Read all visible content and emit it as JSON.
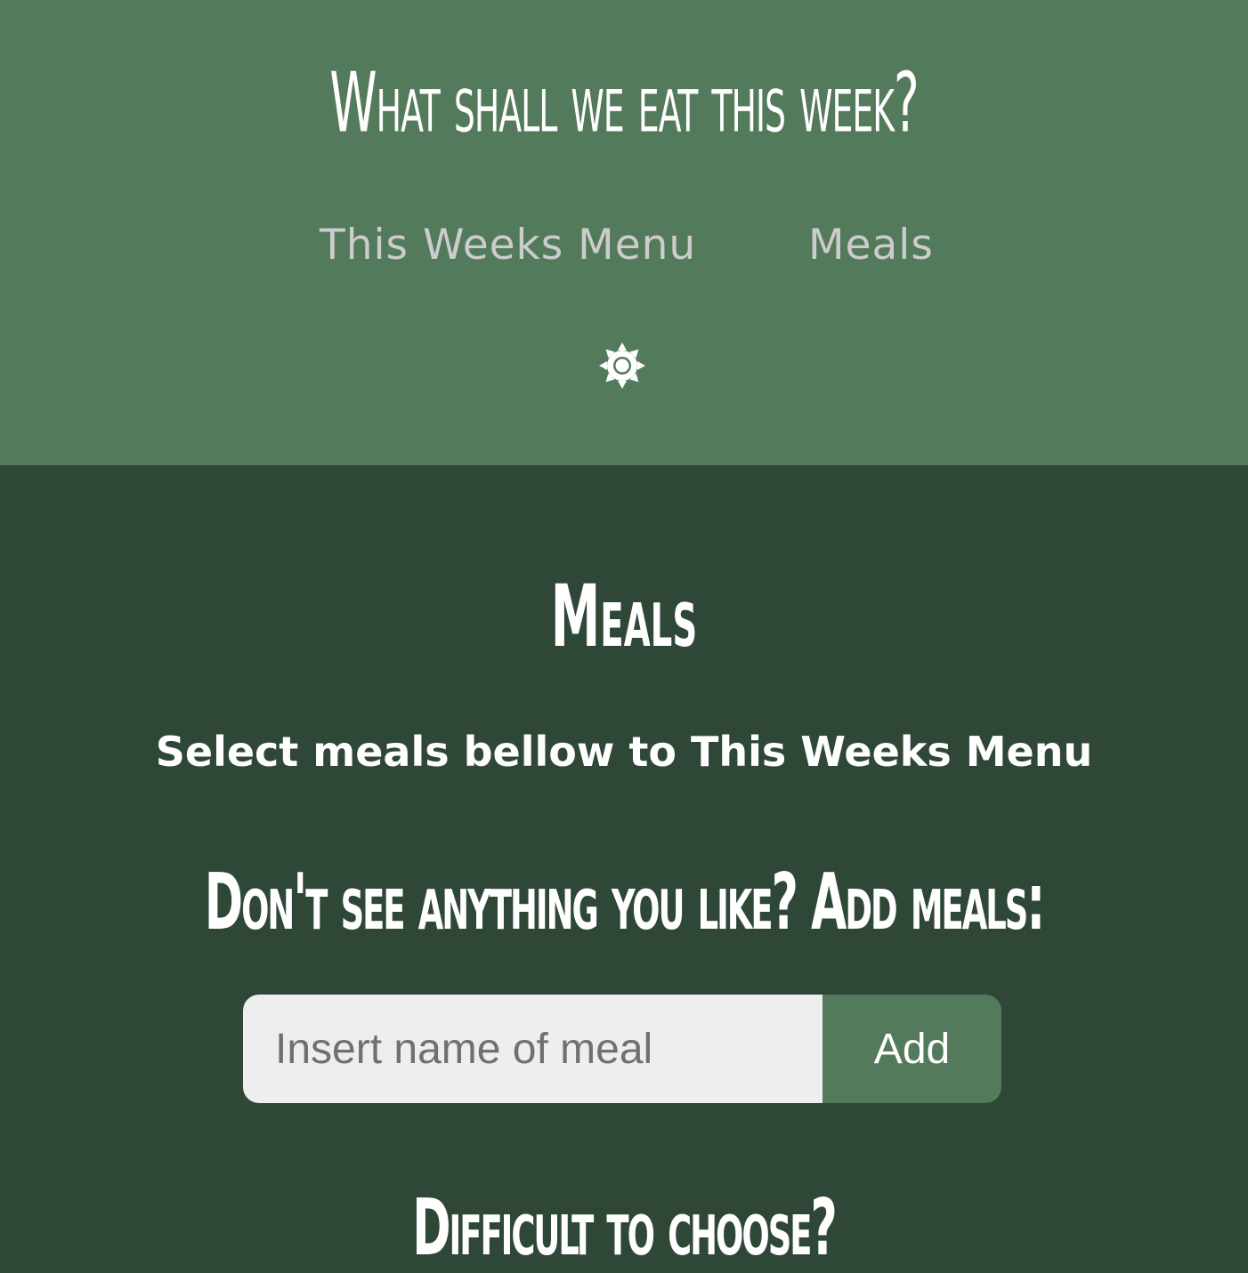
{
  "header": {
    "title": "What shall we eat this week?",
    "nav": [
      {
        "label": "This Weeks Menu"
      },
      {
        "label": "Meals"
      }
    ],
    "theme_toggle_icon": "sun-icon"
  },
  "main": {
    "title": "Meals",
    "subtitle": "Select meals bellow to This Weeks Menu",
    "add_heading": "Don't see anything you like? Add meals:",
    "add_form": {
      "placeholder": "Insert name of meal",
      "value": "",
      "button_label": "Add"
    },
    "choose_heading": "Difficult to choose?"
  },
  "colors": {
    "header_bg": "#547a5c",
    "main_bg": "#2f4737",
    "input_bg": "#eeeeee",
    "button_bg": "#547a5c",
    "nav_text": "#cccccc",
    "text": "#ffffff"
  }
}
